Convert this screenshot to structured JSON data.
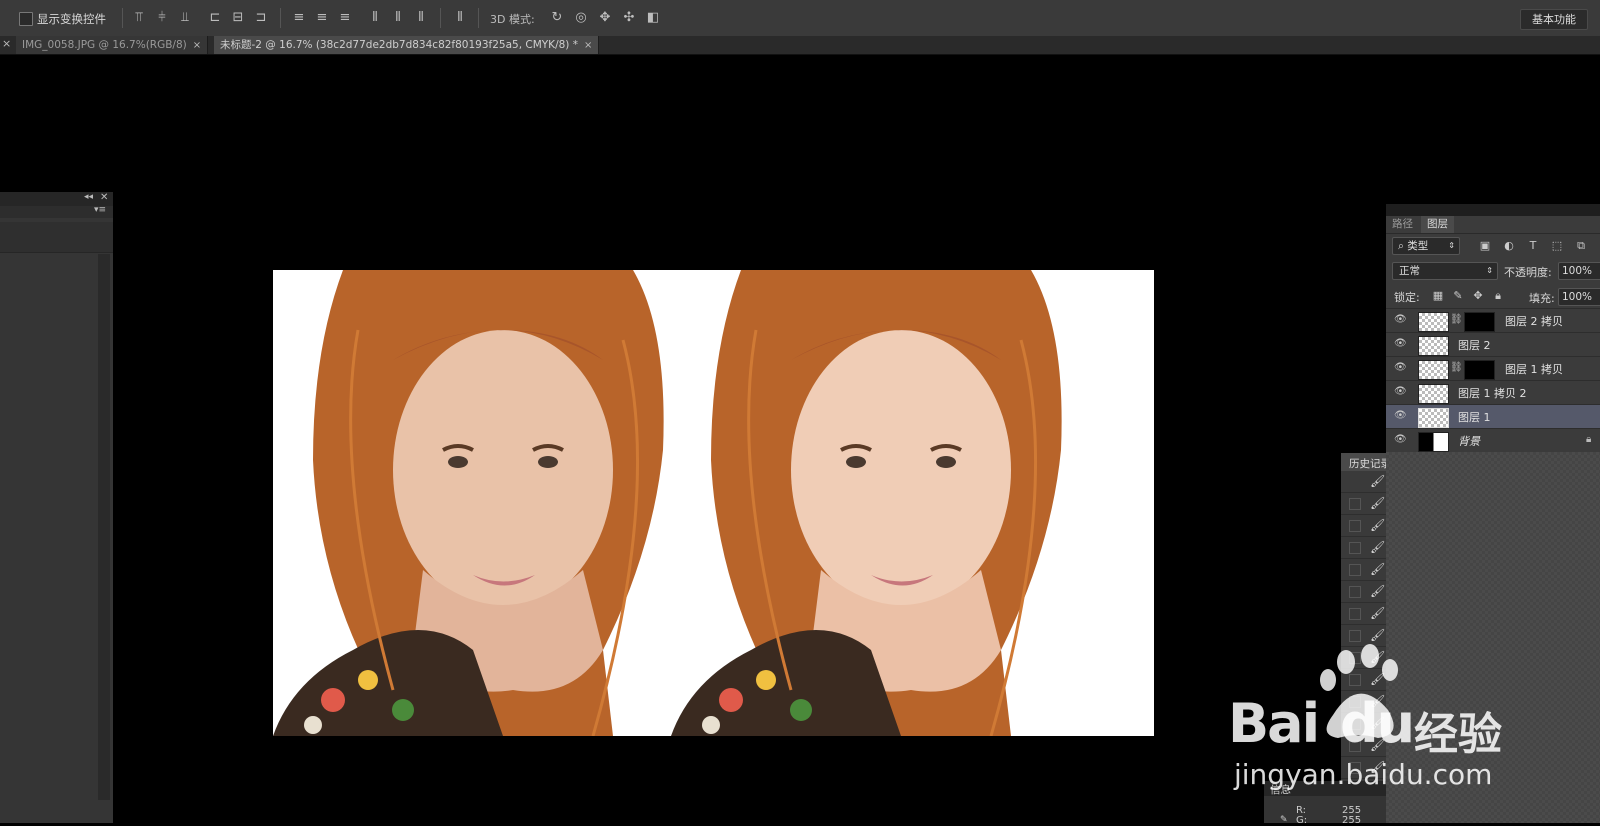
{
  "options_bar": {
    "show_transform_controls": "显示变换控件",
    "mode_3d_label": "3D 模式:",
    "workspace_button": "基本功能"
  },
  "tabs": [
    {
      "label": "IMG_0058.JPG @ 16.7%(RGB/8)",
      "close": "×"
    },
    {
      "label": "未标题-2 @ 16.7% (38c2d77de2db7d834c82f80193f25a5, CMYK/8) *",
      "close": "×"
    }
  ],
  "tab_close_left": "×",
  "layers_panel": {
    "tabs": [
      "路径",
      "图层"
    ],
    "filter_kind": "类型",
    "blend_mode": "正常",
    "opacity_label": "不透明度:",
    "opacity_value": "100%",
    "lock_label": "锁定:",
    "fill_label": "填充:",
    "fill_value": "100%",
    "layers": [
      {
        "name": "图层 2 拷贝",
        "has_mask": true,
        "selected": false
      },
      {
        "name": "图层 2",
        "has_mask": false,
        "selected": false
      },
      {
        "name": "图层 1 拷贝",
        "has_mask": true,
        "selected": false
      },
      {
        "name": "图层 1 拷贝 2",
        "has_mask": false,
        "selected": false
      },
      {
        "name": "图层 1",
        "has_mask": false,
        "selected": true
      },
      {
        "name": "背景",
        "has_mask": false,
        "selected": false,
        "locked": true
      }
    ]
  },
  "history_panel": {
    "title": "历史记录"
  },
  "info_panel": {
    "title": "信息",
    "r_label": "R:",
    "r_value": "255",
    "g_label": "G:",
    "g_value": "255"
  },
  "watermark": {
    "brand": "Bai",
    "brand2": "du",
    "brand_cn": "经验",
    "url": "jingyan.baidu.com"
  },
  "colors": {
    "accent_selected": "#55596a",
    "panel_bg": "#3b3b3b",
    "hair": "#b8642a",
    "skin": "#e9c2a8"
  }
}
